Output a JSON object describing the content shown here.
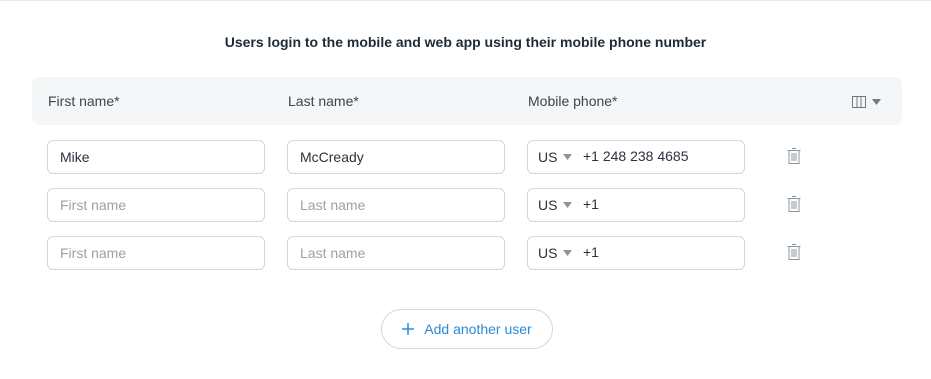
{
  "title": "Users login to the mobile and web app using their mobile phone number",
  "columns": {
    "first_name": "First name*",
    "last_name": "Last name*",
    "mobile_phone": "Mobile phone*"
  },
  "placeholders": {
    "first_name": "First name",
    "last_name": "Last name"
  },
  "rows": [
    {
      "first_name": "Mike",
      "last_name": "McCready",
      "country": "US",
      "phone": "+1 248 238 4685"
    },
    {
      "first_name": "",
      "last_name": "",
      "country": "US",
      "phone": "+1"
    },
    {
      "first_name": "",
      "last_name": "",
      "country": "US",
      "phone": "+1"
    }
  ],
  "add_button": {
    "label": "Add another user",
    "icon": "plus-icon"
  },
  "column_settings_icon": "columns-icon",
  "delete_icon": "trash-icon",
  "colors": {
    "accent": "#2b8ad8",
    "header_bg": "#f5f6f7",
    "border": "#d3d7db",
    "placeholder": "#9aa2aa"
  }
}
